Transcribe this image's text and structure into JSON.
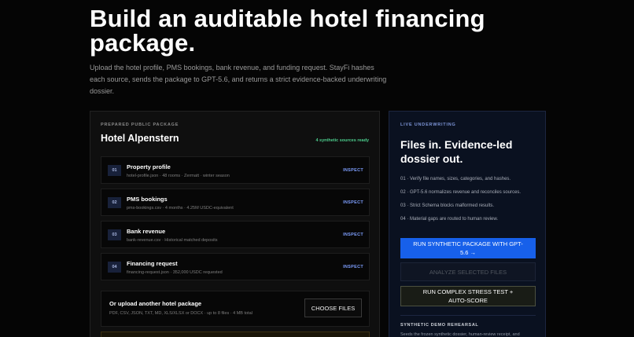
{
  "hero": {
    "title": "Build an auditable hotel financing package.",
    "description": "Upload the hotel profile, PMS bookings, bank revenue, and funding request. StayFi hashes each source, sends the package to GPT-5.6, and returns a strict evidence-backed underwriting dossier."
  },
  "package": {
    "eyebrow": "PREPARED PUBLIC PACKAGE",
    "title": "Hotel Alpenstern",
    "sources_status": "4 synthetic sources ready",
    "inspect_label": "INSPECT",
    "sources": [
      {
        "num": "01",
        "name": "Property profile",
        "meta": "hotel-profile.json · 48 rooms · Zermatt · winter season"
      },
      {
        "num": "02",
        "name": "PMS bookings",
        "meta": "pms-bookings.csv · 4 months · 4.25M USDC-equivalent"
      },
      {
        "num": "03",
        "name": "Bank revenue",
        "meta": "bank-revenue.csv · Historical matched deposits"
      },
      {
        "num": "04",
        "name": "Financing request",
        "meta": "financing-request.json · 352,000 USDC requested"
      }
    ],
    "upload": {
      "title": "Or upload another hotel package",
      "hint": "PDF, CSV, JSON, TXT, MD, XLS/XLSX or DOCX · up to 8 files · 4 MB total",
      "button": "CHOOSE FILES"
    }
  },
  "live": {
    "eyebrow": "LIVE UNDERWRITING",
    "title": "Files in. Evidence-led dossier out.",
    "steps": [
      "01 · Verify file names, sizes, categories, and hashes.",
      "02 · GPT-5.6 normalizes revenue and reconciles sources.",
      "03 · Strict Schema blocks malformed results.",
      "04 · Material gaps are routed to human review."
    ],
    "run_button": "RUN SYNTHETIC PACKAGE WITH GPT-5.6 →",
    "analyze_button": "ANALYZE SELECTED FILES",
    "stress_button": "RUN COMPLEX STRESS TEST + AUTO-SCORE",
    "demo_eyebrow": "SYNTHETIC DEMO REHEARSAL",
    "demo_text": "Seeds the frozen synthetic dossier, human-review receipt, and"
  }
}
